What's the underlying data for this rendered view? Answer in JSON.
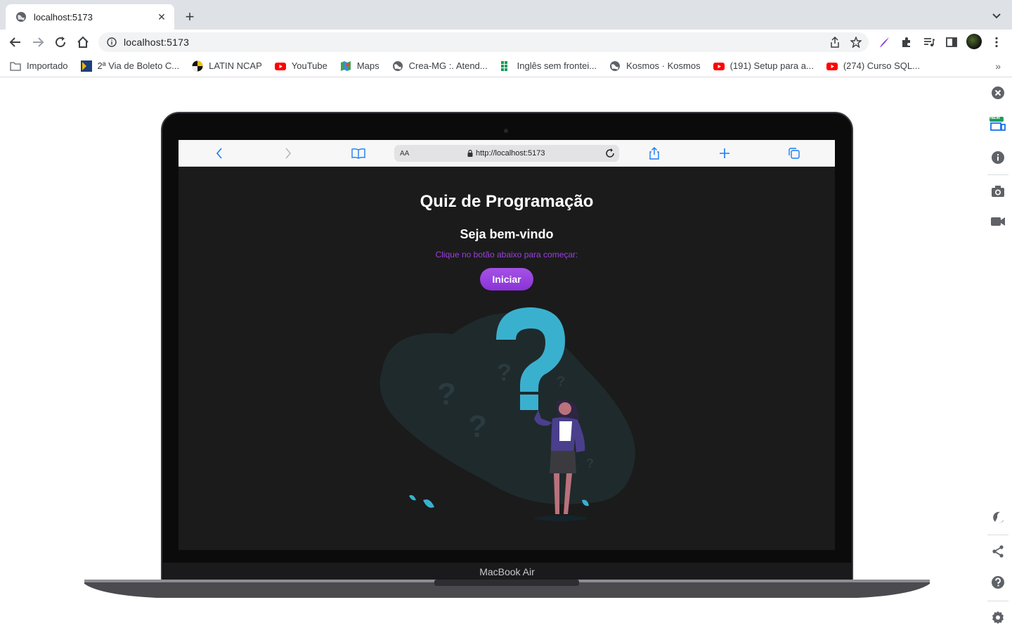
{
  "browser": {
    "tab_title": "localhost:5173",
    "address": "localhost:5173"
  },
  "bookmarks": [
    {
      "label": "Importado",
      "icon": "folder-icon"
    },
    {
      "label": "2ª Via de Boleto C...",
      "icon": "boleto-icon"
    },
    {
      "label": "LATIN NCAP",
      "icon": "latin-ncap-icon"
    },
    {
      "label": "YouTube",
      "icon": "youtube-icon"
    },
    {
      "label": "Maps",
      "icon": "maps-icon"
    },
    {
      "label": "Crea-MG :. Atend...",
      "icon": "globe-icon"
    },
    {
      "label": "Inglês sem frontei...",
      "icon": "grid-icon"
    },
    {
      "label": "Kosmos · Kosmos",
      "icon": "globe-icon"
    },
    {
      "label": "(191) Setup para a...",
      "icon": "youtube-icon"
    },
    {
      "label": "(274) Curso SQL...",
      "icon": "youtube-icon"
    }
  ],
  "side_panel": {
    "new_badge": "NEW"
  },
  "device": {
    "safari_aa": "AA",
    "safari_url": "http://localhost:5173",
    "label": "MacBook Air"
  },
  "app": {
    "title": "Quiz de Programação",
    "subtitle": "Seja bem-vindo",
    "hint": "Clique no botão abaixo para começar:",
    "start_label": "Iniciar"
  },
  "colors": {
    "accent": "#8a33d8",
    "hint": "#9b3fe0",
    "question_mark": "#3ab0cf",
    "app_bg": "#1b1b1b"
  }
}
